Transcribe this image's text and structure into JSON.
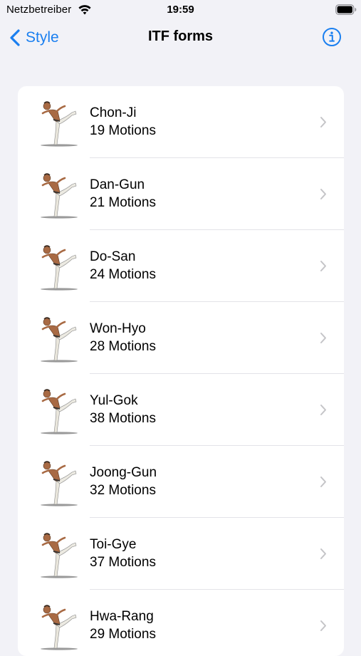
{
  "status_bar": {
    "carrier": "Netzbetreiber",
    "time": "19:59",
    "wifi_icon": "wifi-icon",
    "battery_icon": "battery-full-icon"
  },
  "nav": {
    "back_label": "Style",
    "title": "ITF forms",
    "back_icon": "chevron-left-icon",
    "info_icon": "info-circle-icon"
  },
  "colors": {
    "accent": "#1a7ff0",
    "background": "#f2f2f7",
    "card": "#ffffff",
    "chevron": "#c4c4c7"
  },
  "forms": [
    {
      "name": "Chon-Ji",
      "motions": "19 Motions"
    },
    {
      "name": "Dan-Gun",
      "motions": "21 Motions"
    },
    {
      "name": "Do-San",
      "motions": "24 Motions"
    },
    {
      "name": "Won-Hyo",
      "motions": "28 Motions"
    },
    {
      "name": "Yul-Gok",
      "motions": "38 Motions"
    },
    {
      "name": "Joong-Gun",
      "motions": "32 Motions"
    },
    {
      "name": "Toi-Gye",
      "motions": "37 Motions"
    },
    {
      "name": "Hwa-Rang",
      "motions": "29 Motions"
    }
  ]
}
